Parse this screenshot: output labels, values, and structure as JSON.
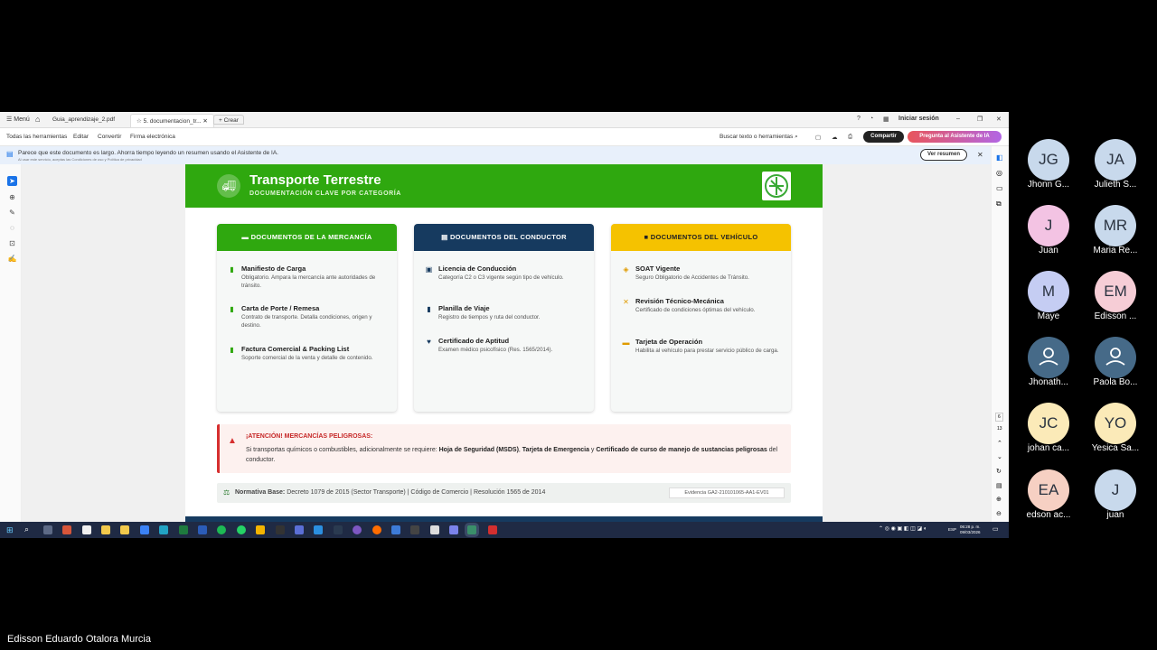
{
  "acrobat": {
    "menu_label": "Menú",
    "tabs": [
      "Guia_aprendizaje_2.pdf",
      "5. documentacion_tr...",
      "Crear"
    ],
    "login": "Iniciar sesión",
    "toolbar": [
      "Todas las herramientas",
      "Editar",
      "Convertir",
      "Firma electrónica"
    ],
    "search": "Buscar texto o herramientas",
    "share": "Compartir",
    "ai_button": "Pregunta al Asistente de IA",
    "info_message": "Parece que este documento es largo. Ahorra tiempo leyendo un resumen usando el Asistente de IA.",
    "info_sub": "Al usar este servicio, aceptas las Condiciones de uso y Política de privacidad",
    "summary_button": "Ver resumen",
    "page_numbers": [
      "6",
      "13"
    ]
  },
  "document": {
    "title": "Transporte Terrestre",
    "subtitle": "DOCUMENTACIÓN CLAVE POR CATEGORÍA",
    "cards": [
      {
        "header": "DOCUMENTOS DE LA MERCANCÍA",
        "color": "#2fa80f",
        "items": [
          {
            "title": "Manifiesto de Carga",
            "desc": "Obligatorio. Ampara la mercancía ante autoridades de tránsito."
          },
          {
            "title": "Carta de Porte / Remesa",
            "desc": "Contrato de transporte. Detalla condiciones, origen y destino."
          },
          {
            "title": "Factura Comercial & Packing List",
            "desc": "Soporte comercial de la venta y detalle de contenido."
          }
        ]
      },
      {
        "header": "DOCUMENTOS DEL CONDUCTOR",
        "color": "#163a5f",
        "items": [
          {
            "title": "Licencia de Conducción",
            "desc": "Categoría C2 o C3 vigente según tipo de vehículo."
          },
          {
            "title": "Planilla de Viaje",
            "desc": "Registro de tiempos y ruta del conductor."
          },
          {
            "title": "Certificado de Aptitud",
            "desc": "Examen médico psicofísico (Res. 1565/2014)."
          }
        ]
      },
      {
        "header": "DOCUMENTOS DEL VEHÍCULO",
        "color": "#f5c200",
        "items": [
          {
            "title": "SOAT Vigente",
            "desc": "Seguro Obligatorio de Accidentes de Tránsito."
          },
          {
            "title": "Revisión Técnico-Mecánica",
            "desc": "Certificado de condiciones óptimas del vehículo."
          },
          {
            "title": "Tarjeta de Operación",
            "desc": "Habilita al vehículo para prestar servicio público de carga."
          }
        ]
      }
    ],
    "warning": {
      "title": "¡ATENCIÓN! MERCANCÍAS PELIGROSAS:",
      "text_before": "Si transportas químicos o combustibles, adicionalmente se requiere: ",
      "bold1": "Hoja de Seguridad (MSDS)",
      "sep1": ", ",
      "bold2": "Tarjeta de Emergencia",
      "sep2": " y ",
      "bold3": "Certificado de curso de manejo de sustancias peligrosas",
      "text_after": " del conductor."
    },
    "norm_label": "Normativa Base:",
    "norm_text": " Decreto 1079 de 2015 (Sector Transporte) | Código de Comercio | Resolución 1565 de 2014",
    "evidence": "Evidencia GA2-210101065-AA1-EV01"
  },
  "taskbar": {
    "lang": "ESP",
    "time": "06:28 p. m.",
    "date": "09/03/2026"
  },
  "participants": [
    {
      "initials": "JG",
      "name": "Jhonn G...",
      "color": "#c8d9ec"
    },
    {
      "initials": "JA",
      "name": "Julieth S...",
      "color": "#c8d9ec"
    },
    {
      "initials": "J",
      "name": "Juan",
      "color": "#f3c3e3"
    },
    {
      "initials": "MR",
      "name": "Maria Re...",
      "color": "#c8d9ec"
    },
    {
      "initials": "M",
      "name": "Maye",
      "color": "#c5cdf3"
    },
    {
      "initials": "EM",
      "name": "Edisson ...",
      "color": "#f6cdd6"
    },
    {
      "initials": "",
      "name": "Jhonath...",
      "color": "#466a88"
    },
    {
      "initials": "",
      "name": "Paola Bo...",
      "color": "#466a88"
    },
    {
      "initials": "JC",
      "name": "johan ca...",
      "color": "#fbeab8"
    },
    {
      "initials": "YO",
      "name": "Yesica Sa...",
      "color": "#fbeab8"
    },
    {
      "initials": "EA",
      "name": "edson ac...",
      "color": "#f6d0c3"
    },
    {
      "initials": "J",
      "name": "juan",
      "color": "#c8d9ec"
    }
  ],
  "speaker": "Edisson Eduardo Otalora Murcia"
}
